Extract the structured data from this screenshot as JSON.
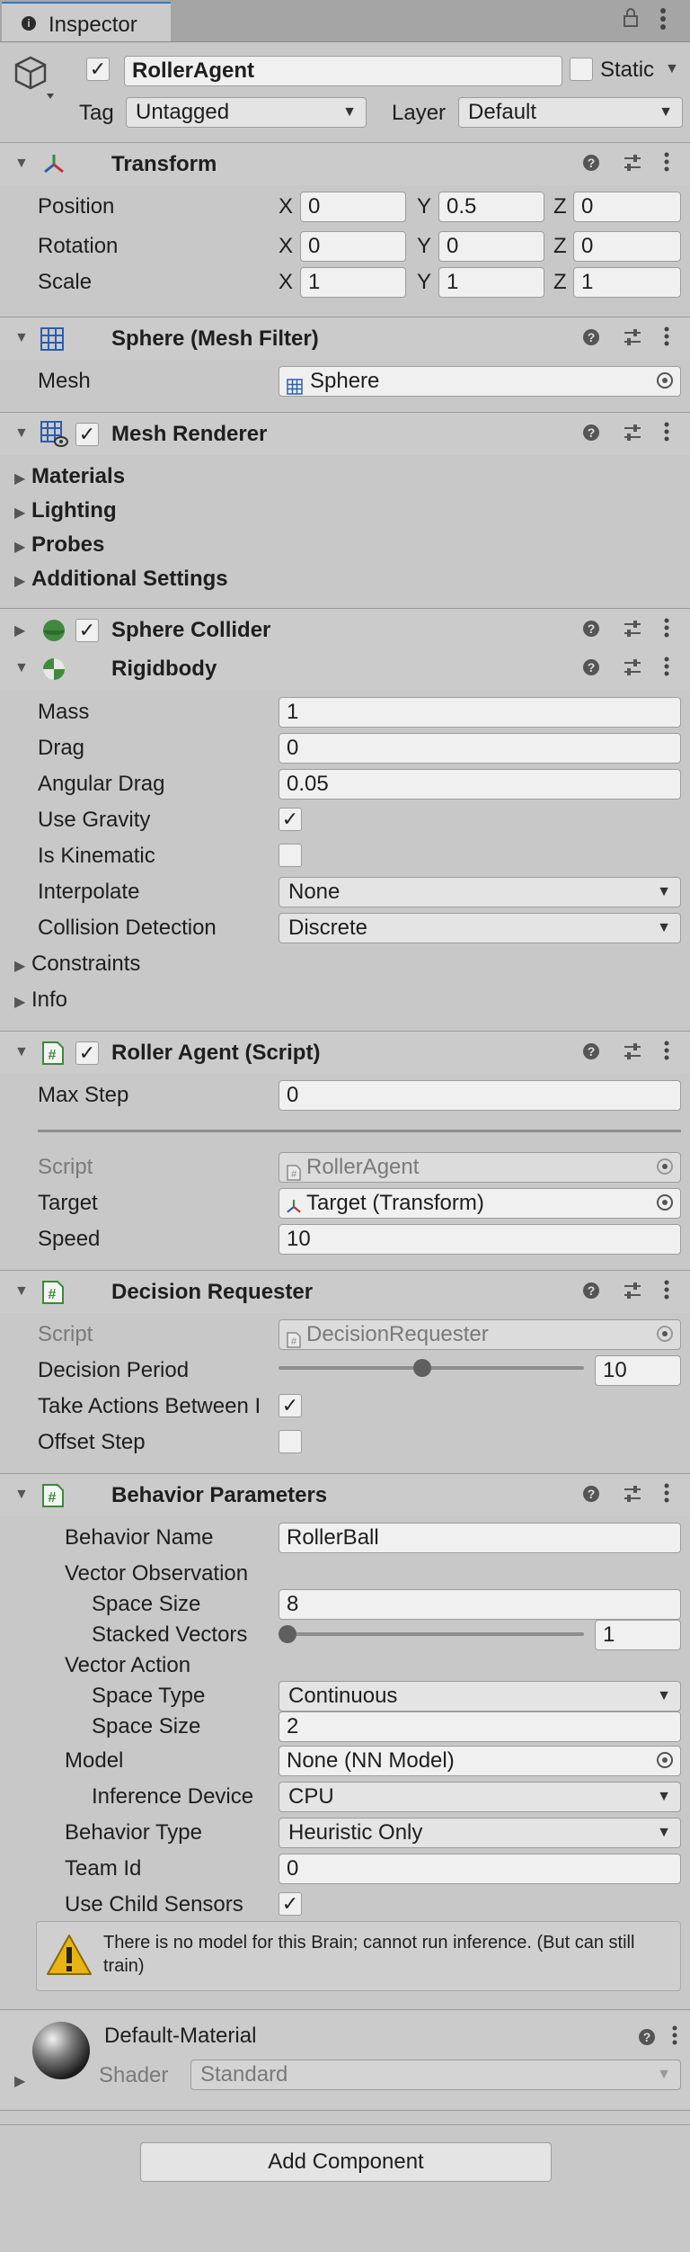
{
  "tab": {
    "label": "Inspector",
    "info_icon": "info-icon",
    "lock_icon": "lock-icon",
    "menu_icon": "kebab-menu-icon"
  },
  "gameobject": {
    "name": "RollerAgent",
    "active": true,
    "static_label": "Static",
    "static": false,
    "tag_label": "Tag",
    "tag_value": "Untagged",
    "layer_label": "Layer",
    "layer_value": "Default"
  },
  "transform": {
    "title": "Transform",
    "position": {
      "label": "Position",
      "x": "0",
      "y": "0.5",
      "z": "0"
    },
    "rotation": {
      "label": "Rotation",
      "x": "0",
      "y": "0",
      "z": "0"
    },
    "scale": {
      "label": "Scale",
      "x": "1",
      "y": "1",
      "z": "1"
    },
    "axis_x": "X",
    "axis_y": "Y",
    "axis_z": "Z"
  },
  "mesh_filter": {
    "title": "Sphere (Mesh Filter)",
    "mesh_label": "Mesh",
    "mesh_value": "Sphere"
  },
  "mesh_renderer": {
    "title": "Mesh Renderer",
    "foldouts": [
      "Materials",
      "Lighting",
      "Probes",
      "Additional Settings"
    ]
  },
  "sphere_collider": {
    "title": "Sphere Collider"
  },
  "rigidbody": {
    "title": "Rigidbody",
    "mass_label": "Mass",
    "mass": "1",
    "drag_label": "Drag",
    "drag": "0",
    "angular_drag_label": "Angular Drag",
    "angular_drag": "0.05",
    "use_gravity_label": "Use Gravity",
    "use_gravity": true,
    "is_kinematic_label": "Is Kinematic",
    "is_kinematic": false,
    "interpolate_label": "Interpolate",
    "interpolate": "None",
    "collision_label": "Collision Detection",
    "collision": "Discrete",
    "constraints_label": "Constraints",
    "info_label": "Info"
  },
  "roller_agent": {
    "title": "Roller Agent (Script)",
    "max_step_label": "Max Step",
    "max_step": "0",
    "script_label": "Script",
    "script_value": "RollerAgent",
    "target_label": "Target",
    "target_value": "Target (Transform)",
    "speed_label": "Speed",
    "speed": "10"
  },
  "decision_requester": {
    "title": "Decision Requester",
    "script_label": "Script",
    "script_value": "DecisionRequester",
    "period_label": "Decision Period",
    "period": "10",
    "period_fraction": 0.47,
    "take_actions_label": "Take Actions Between I",
    "take_actions": true,
    "offset_label": "Offset Step",
    "offset": false
  },
  "behavior_parameters": {
    "title": "Behavior Parameters",
    "behavior_name_label": "Behavior Name",
    "behavior_name": "RollerBall",
    "vector_obs_label": "Vector Observation",
    "space_size_label": "Space Size",
    "obs_space_size": "8",
    "stacked_label": "Stacked Vectors",
    "stacked": "1",
    "stacked_fraction": 0.0,
    "vector_action_label": "Vector Action",
    "space_type_label": "Space Type",
    "space_type": "Continuous",
    "action_space_size_label": "Space Size",
    "action_space_size": "2",
    "model_label": "Model",
    "model": "None (NN Model)",
    "inference_label": "Inference Device",
    "inference": "CPU",
    "behavior_type_label": "Behavior Type",
    "behavior_type": "Heuristic Only",
    "team_id_label": "Team Id",
    "team_id": "0",
    "child_sensors_label": "Use Child Sensors",
    "child_sensors": true,
    "warning": "There is no model for this Brain; cannot run inference. (But can still train)"
  },
  "material": {
    "title": "Default-Material",
    "shader_label": "Shader",
    "shader": "Standard"
  },
  "add_component": "Add Component",
  "colors": {
    "accent": "#3a79bb",
    "background": "#c8c8c8",
    "header": "#cbcbcb",
    "field": "#f0f0f0"
  }
}
